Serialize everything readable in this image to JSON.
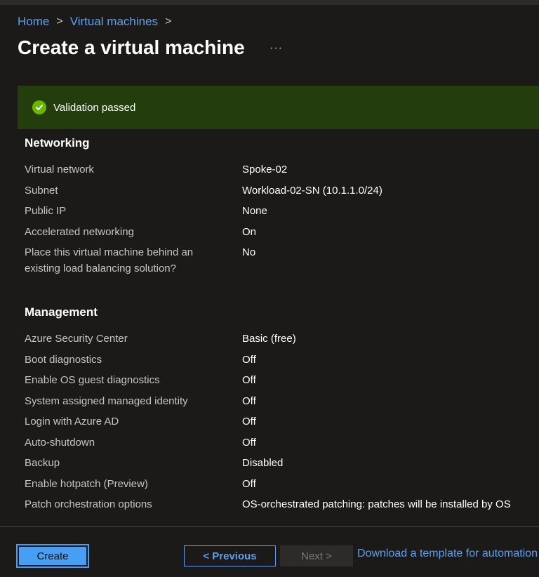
{
  "breadcrumb": {
    "home": "Home",
    "sep1": ">",
    "virtual_machines": "Virtual machines",
    "sep2": ">"
  },
  "page": {
    "title": "Create a virtual machine",
    "more": "···"
  },
  "validation": {
    "text": "Validation passed",
    "icon": "checkmark-circle-icon",
    "color": "#6bb700"
  },
  "networking": {
    "title": "Networking",
    "rows": [
      {
        "label": "Virtual network",
        "value": "Spoke-02"
      },
      {
        "label": "Subnet",
        "value": "Workload-02-SN (10.1.1.0/24)"
      },
      {
        "label": "Public IP",
        "value": "None"
      },
      {
        "label": "Accelerated networking",
        "value": "On"
      },
      {
        "label": "Place this virtual machine behind an existing load balancing solution?",
        "value": "No"
      }
    ]
  },
  "management": {
    "title": "Management",
    "rows": [
      {
        "label": "Azure Security Center",
        "value": "Basic (free)"
      },
      {
        "label": "Boot diagnostics",
        "value": "Off"
      },
      {
        "label": "Enable OS guest diagnostics",
        "value": "Off"
      },
      {
        "label": "System assigned managed identity",
        "value": "Off"
      },
      {
        "label": "Login with Azure AD",
        "value": "Off"
      },
      {
        "label": "Auto-shutdown",
        "value": "Off"
      },
      {
        "label": "Backup",
        "value": "Disabled"
      },
      {
        "label": "Enable hotpatch (Preview)",
        "value": "Off"
      },
      {
        "label": "Patch orchestration options",
        "value": "OS-orchestrated patching: patches will be installed by OS"
      }
    ]
  },
  "footer": {
    "create": "Create",
    "previous": "< Previous",
    "next": "Next >",
    "download": "Download a template for automation"
  },
  "colors": {
    "accent": "#479ef5",
    "link": "#5ea0ef",
    "banner_bg": "#233d0c",
    "background": "#1b1a19"
  }
}
